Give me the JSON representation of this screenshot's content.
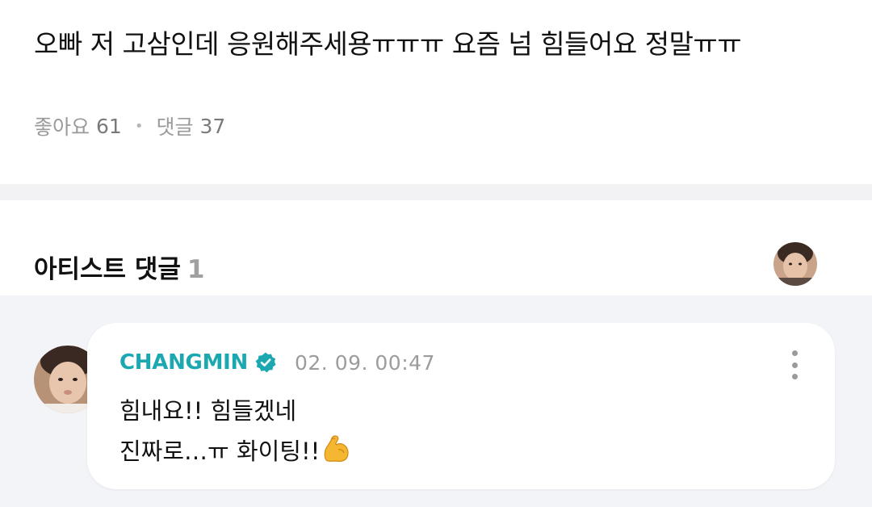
{
  "post": {
    "text": "오빠 저 고삼인데 응원해주세용ㅠㅠㅠ 요즘 넘 힘들어요 정말ㅠㅠ",
    "likes_label": "좋아요",
    "likes_count": "61",
    "comments_label": "댓글",
    "comments_count": "37"
  },
  "artist_comments": {
    "title": "아티스트 댓글",
    "count": "1"
  },
  "comment": {
    "author": "CHANGMIN",
    "timestamp": "02. 09. 00:47",
    "line1": "힘내요!! 힘들겠네",
    "line2": "진짜로…ㅠ 화이팅!!",
    "emoji": "flexed-biceps-icon"
  },
  "colors": {
    "author": "#1ba8b0",
    "verified_badge": "#1ba8b0",
    "comment_background": "#f3f4f7",
    "divider": "#f2f2f4"
  }
}
